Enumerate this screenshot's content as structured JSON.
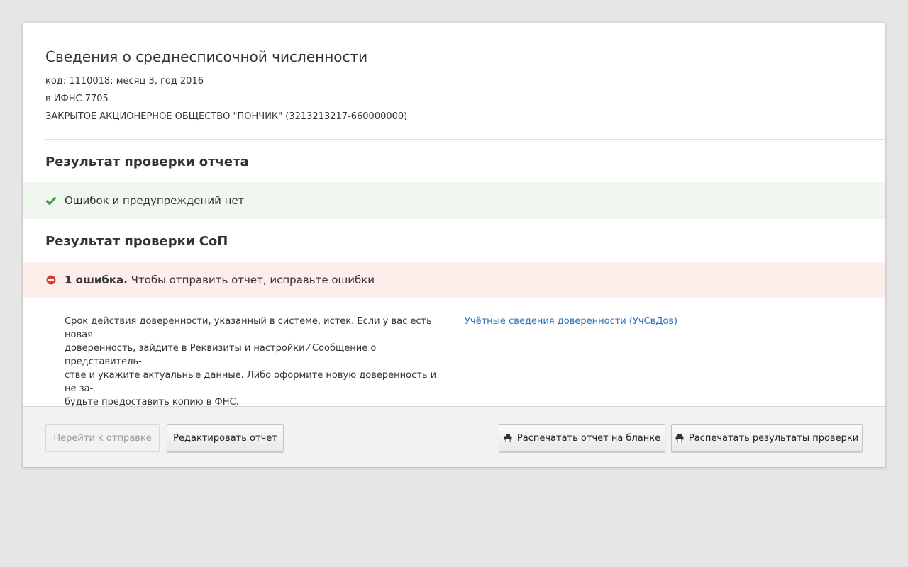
{
  "report": {
    "title": "Сведения о среднесписочной численности",
    "code_line": "код: 1110018; месяц 3, год 2016",
    "ifns_line": "в ИФНС 7705",
    "org_line": "ЗАКРЫТОЕ АКЦИОНЕРНОЕ ОБЩЕСТВО \"ПОНЧИК\" (3213213217-660000000)"
  },
  "check_report": {
    "title": "Результат проверки отчета",
    "status_text": "Ошибок и предупреждений нет",
    "status_icon": "check-icon",
    "status_color": "#eff7ee",
    "icon_color": "#3a9a35"
  },
  "check_sop": {
    "title": "Результат проверки СоП",
    "error_count": "1 ошибка.",
    "status_text": "Чтобы отправить отчет, исправьте ошибки",
    "status_icon": "error-icon",
    "status_color": "#fdedeb",
    "icon_color": "#d33d2c",
    "error_lines": [
      "Срок действия доверенности, указанный в системе, истек. Если у вас есть новая",
      "доверенность, зайдите в Реквизиты и настройки ⁄ Сообщение о представитель-",
      "стве и укажите актуальные данные. Либо оформите новую доверенность и не за-",
      "будьте предоставить копию в ФНС."
    ],
    "error_link": "Учётные сведения доверенности (УчСвДов)",
    "link_color": "#2e72b8"
  },
  "footer": {
    "send_button": "Перейти к отправке",
    "edit_button": "Редактировать отчет",
    "print_form_button": "Распечатать отчет на бланке",
    "print_results_button": "Распечатать результаты проверки",
    "print_icon": "printer-icon"
  }
}
